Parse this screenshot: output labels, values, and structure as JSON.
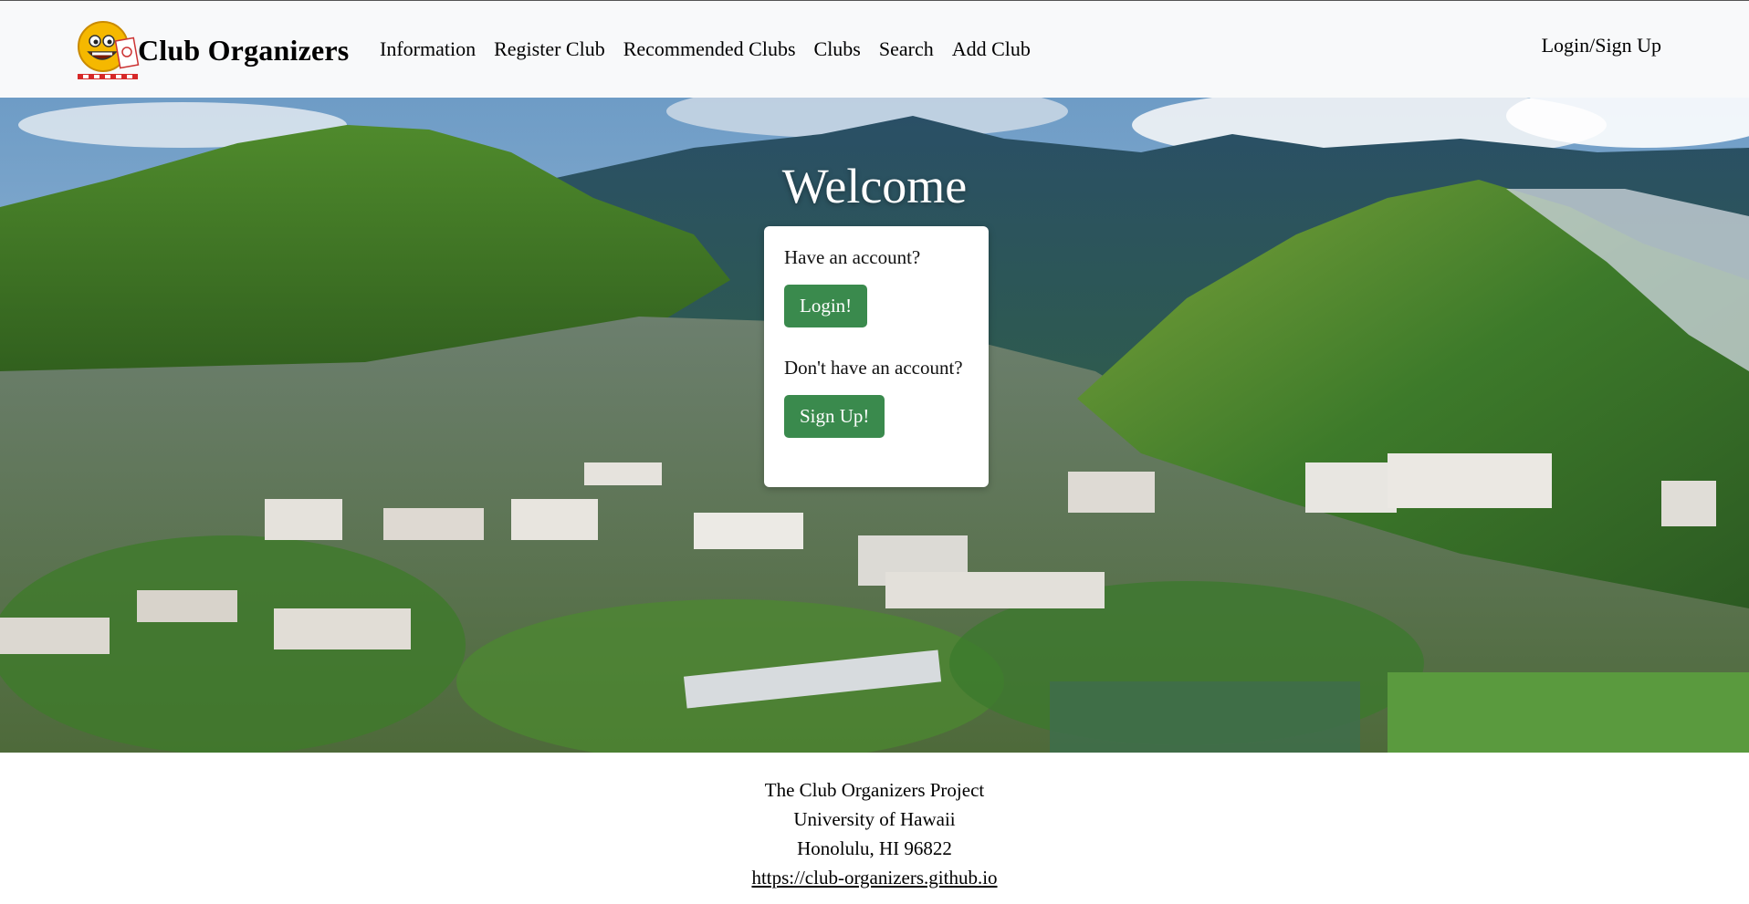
{
  "navbar": {
    "brand": "Club Organizers",
    "logo_icon": "smiley-logo-icon",
    "links": [
      {
        "label": "Information"
      },
      {
        "label": "Register Club"
      },
      {
        "label": "Recommended Clubs"
      },
      {
        "label": "Clubs"
      },
      {
        "label": "Search"
      },
      {
        "label": "Add Club"
      }
    ],
    "login_label": "Login/Sign Up"
  },
  "hero": {
    "title": "Welcome",
    "background": "campus-aerial-photo",
    "card": {
      "have_account_text": "Have an account?",
      "login_button": "Login!",
      "no_account_text": "Don't have an account?",
      "signup_button": "Sign Up!"
    }
  },
  "footer": {
    "line1": "The Club Organizers Project",
    "line2": "University of Hawaii",
    "line3": "Honolulu, HI 96822",
    "link": "https://club-organizers.github.io"
  },
  "colors": {
    "navbar_bg": "#f8f9fa",
    "button_green": "#3a8a4d"
  }
}
